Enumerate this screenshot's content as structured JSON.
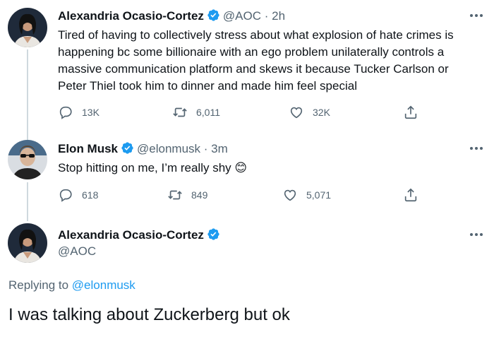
{
  "tweets": [
    {
      "name": "Alexandria Ocasio-Cortez",
      "handle": "@AOC",
      "separator": "·",
      "time": "2h",
      "text_lines": [
        "Tired of having to collectively stress about what explosion of hate crimes is",
        "happening bc some billionaire with an ego problem unilaterally controls a",
        "massive communication platform and skews it because Tucker Carlson or",
        "Peter Thiel took him to dinner and made him feel special"
      ],
      "replies": "13K",
      "retweets": "6,011",
      "likes": "32K"
    },
    {
      "name": "Elon Musk",
      "handle": "@elonmusk",
      "separator": "·",
      "time": "3m",
      "text": "Stop hitting on me, I’m really shy",
      "emoji": "😊",
      "replies": "618",
      "retweets": "849",
      "likes": "5,071"
    }
  ],
  "main_tweet": {
    "name": "Alexandria Ocasio-Cortez",
    "handle": "@AOC",
    "replying_prefix": "Replying to",
    "replying_to": "@elonmusk",
    "text": "I was talking about Zuckerberg but ok"
  },
  "colors": {
    "verified": "#1d9bf0",
    "secondary_text": "#536471",
    "link": "#1d9bf0",
    "thread_line": "#cfd9de"
  },
  "icons": [
    "reply-icon",
    "retweet-icon",
    "like-icon",
    "share-icon",
    "verified-badge-icon",
    "more-icon",
    "emoji-blush-icon"
  ]
}
